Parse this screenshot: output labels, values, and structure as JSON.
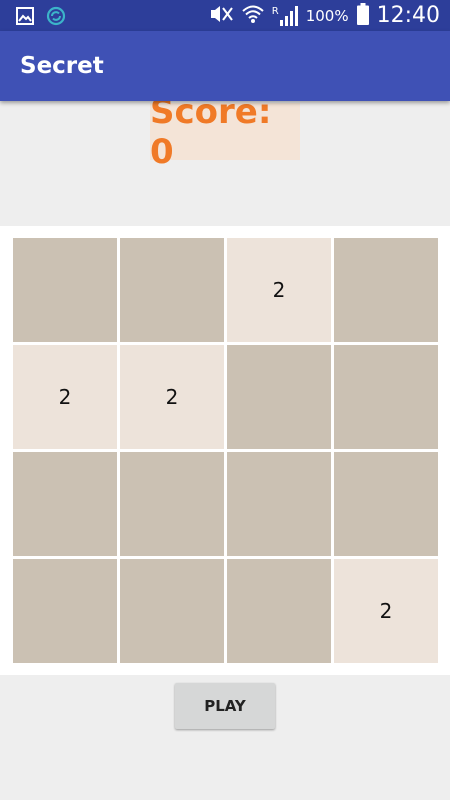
{
  "status_bar": {
    "left_icons": [
      "gallery-icon",
      "sync-icon"
    ],
    "right_icons": [
      "mute-icon",
      "wifi-icon",
      "signal-icon",
      "battery-icon"
    ],
    "signal_label": "R",
    "battery": "100%",
    "time": "12:40"
  },
  "app_bar": {
    "title": "Secret"
  },
  "score": {
    "label": "Score: 0"
  },
  "board": {
    "rows": [
      [
        "",
        "",
        "2",
        ""
      ],
      [
        "2",
        "2",
        "",
        ""
      ],
      [
        "",
        "",
        "",
        ""
      ],
      [
        "",
        "",
        "",
        "2"
      ]
    ],
    "colors": {
      "empty": "#CBC1B3",
      "tile_2": "#EDE3DA",
      "score_text": "#F07A27"
    }
  },
  "play_button": {
    "label": "PLAY"
  }
}
